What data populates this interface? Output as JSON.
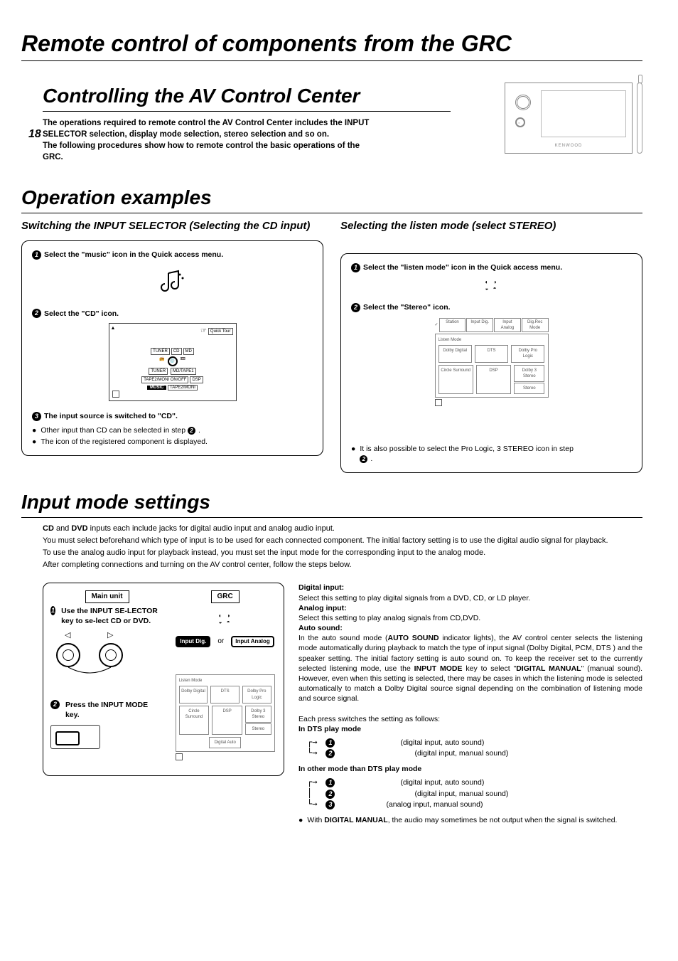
{
  "page_number": "18",
  "main_heading": "Remote control of components from the GRC",
  "section1_heading": "Controlling the AV Control Center",
  "intro_text": "The operations required to remote control the AV Control Center includes the INPUT SELECTOR selection, display mode selection, stereo selection and so on.\nThe following procedures show how to remote control the basic operations of the GRC.",
  "section2_heading": "Operation examples",
  "sub_left": "Switching the INPUT SELECTOR (Selecting the CD input)",
  "sub_right": "Selecting the listen mode  (select STEREO)",
  "left_panel": {
    "step1": "Select the \"music\" icon in the Quick access menu.",
    "step2": "Select the \"CD\" icon.",
    "step3": "The input source is switched to \"CD\".",
    "bullet1": "Other input than CD can be selected in step ",
    "bullet1_ref": "2",
    "bullet1_after": ".",
    "bullet2": "The icon of the registered component is displayed.",
    "menu_labels": {
      "quick": "Quick Tour",
      "tuner": "TUNER",
      "cd": "CD",
      "md": "MD",
      "tape": "MD/TAPE1",
      "tape2": "TAPE2/MONI ON/OFF",
      "dsp": "DSP",
      "music": "MUSIC",
      "tape2mon": "TAPE2/MONI"
    }
  },
  "right_panel": {
    "step1": "Select the \"listen mode\" icon in the Quick access menu.",
    "step2": "Select the \"Stereo\" icon.",
    "bullet1": "It is also possible to select the Pro Logic, 3 STEREO icon in step ",
    "bullet1_ref": "2",
    "bullet1_after": ".",
    "listen": {
      "tabs": [
        "Station",
        "Input Dig.",
        "Input Analog",
        "Dig.Rec Mode"
      ],
      "title": "Listen Mode",
      "cells": [
        "Dolby Digital",
        "DTS",
        "Dolby Pro Logic",
        "Circle Surround",
        "DSP",
        "Dolby 3 Stereo",
        "",
        "",
        "Stereo"
      ]
    }
  },
  "section3_heading": "Input mode settings",
  "input_mode_intro": {
    "p1a": "CD",
    "p1b": " and ",
    "p1c": "DVD",
    "p1d": " inputs each include jacks for digital audio input and analog audio input.",
    "p2": "You must select beforehand which type of input is to be used for each connected component. The initial factory setting is to use the digital audio signal for playback.",
    "p3": "To use the analog audio input for playback instead, you must set the input mode for the corresponding input to the analog mode.",
    "p4": "After completing connections and turning on the AV control center, follow the steps below."
  },
  "lower_panel": {
    "main_unit": "Main unit",
    "grc": "GRC",
    "step1": "Use the INPUT SE-LECTOR key to se-lect CD or DVD.",
    "or": "or",
    "input_dig": "Input Dig.",
    "input_analog": "Input Analog",
    "step2": "Press the INPUT MODE key.",
    "listen_title": "Listen Mode",
    "listen_cells": [
      "Dolby Digital",
      "DTS",
      "Dolby Pro Logic",
      "Circle Surround",
      "DSP",
      "Dolby 3 Stereo",
      "",
      "Digital Auto",
      "Stereo"
    ]
  },
  "right_text": {
    "digital_h": "Digital input:",
    "digital_p": "Select this setting to play digital signals from a DVD, CD, or LD player.",
    "analog_h": "Analog input:",
    "analog_p": "Select this setting to play analog signals from CD,DVD.",
    "auto_h": "Auto sound:",
    "auto_p_a": "In the auto sound mode (",
    "auto_p_b": "AUTO SOUND",
    "auto_p_c": " indicator lights), the AV control center selects the listening mode automatically during playback to match the type of input signal (Dolby Digital, PCM, DTS ) and the speaker setting. The initial factory setting is auto sound on. To keep the receiver set to the currently selected listening mode, use the ",
    "auto_p_d": "INPUT MODE",
    "auto_p_e": " key to select \"",
    "auto_p_f": "DIGITAL MANUAL",
    "auto_p_g": "\" (manual sound). However, even when this setting is selected, there may be cases in which the listening mode is selected automatically to match a Dolby Digital source signal depending on the combination of listening mode and source signal.",
    "switch_intro": "Each press switches the setting as follows:",
    "dts_h": "In DTS play mode",
    "dts_1": "(digital input, auto sound)",
    "dts_2": "(digital input, manual sound)",
    "other_h": "In other mode than DTS play mode",
    "other_1": "(digital input, auto sound)",
    "other_2": "(digital input, manual sound)",
    "other_3": "(analog input, manual sound)",
    "final_a": "With ",
    "final_b": "DIGITAL MANUAL",
    "final_c": ", the audio may sometimes be not output when the signal is switched."
  }
}
